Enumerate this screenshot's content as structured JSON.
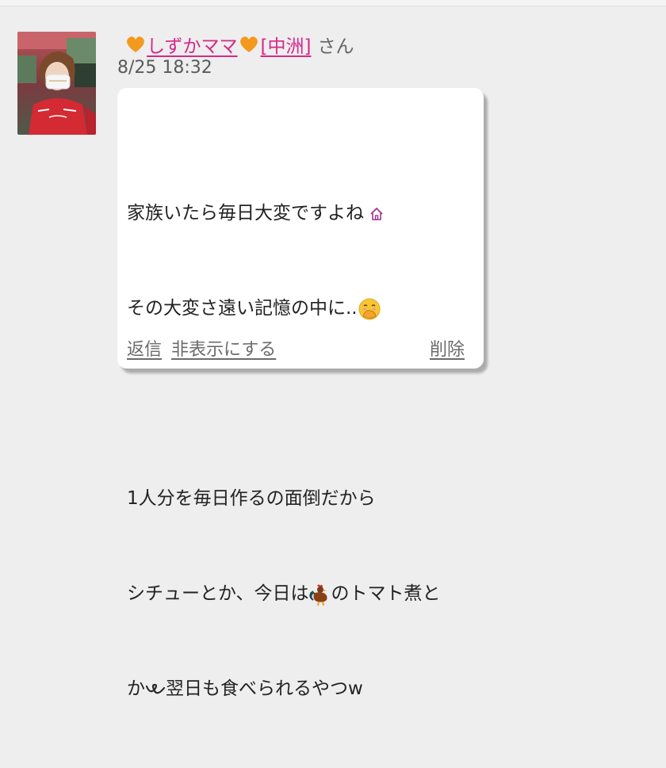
{
  "message": {
    "sender": {
      "name": "しずかママ",
      "area": "[中洲]",
      "honorific": "さん"
    },
    "timestamp": "8/25 18:32",
    "lines": {
      "l1": "家族いたら毎日大変ですよね",
      "l2": "その大変さ遠い記憶の中に..",
      "l3": "1人分を毎日作るの面倒だから",
      "l4a": "シチューとか、今日は",
      "l4b": "のトマト煮と",
      "l5a": "か",
      "l5b": "翌日も食べられるやつw"
    },
    "actions": {
      "reply": "返信",
      "hide": "非表示にする",
      "delete": "削除"
    }
  },
  "colors": {
    "name_link": "#d6288a",
    "heart": "#f39a1e",
    "page_bg": "#eeeeee",
    "bubble_bg": "#ffffff",
    "action_text": "#6b6b6b"
  },
  "icons": {
    "heart": "orange-heart-emoji",
    "house": "house-emoji",
    "hand_over_mouth": "face-with-hand-over-mouth-emoji",
    "rooster": "rooster-emoji",
    "curly_loop": "curly-loop-emoji"
  }
}
